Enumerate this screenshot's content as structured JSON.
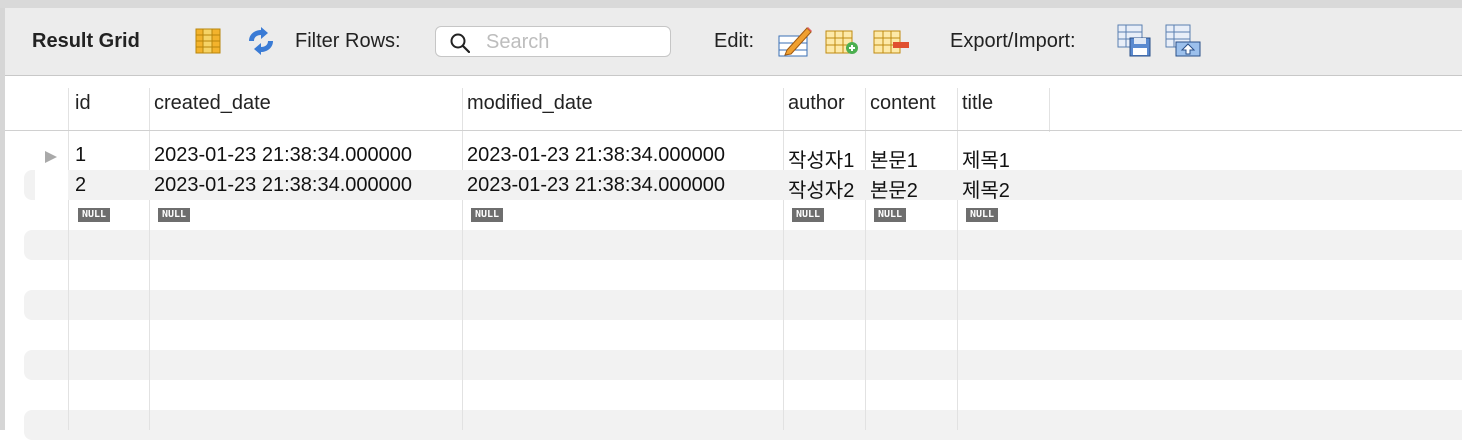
{
  "toolbar": {
    "title": "Result Grid",
    "filter_label": "Filter Rows:",
    "search_placeholder": "Search",
    "edit_label": "Edit:",
    "export_label": "Export/Import:"
  },
  "columns": [
    "id",
    "created_date",
    "modified_date",
    "author",
    "content",
    "title"
  ],
  "rows": [
    {
      "id": "1",
      "created_date": "2023-01-23 21:38:34.000000",
      "modified_date": "2023-01-23 21:38:34.000000",
      "author": "작성자1",
      "content": "본문1",
      "title": "제목1"
    },
    {
      "id": "2",
      "created_date": "2023-01-23 21:38:34.000000",
      "modified_date": "2023-01-23 21:38:34.000000",
      "author": "작성자2",
      "content": "본문2",
      "title": "제목2"
    }
  ],
  "null_label": "NULL",
  "colors": {
    "toolbar_bg": "#ececec",
    "alt_row": "#f2f2f2",
    "null_badge": "#6e6e6e",
    "icon_blue": "#3a7bd5"
  }
}
